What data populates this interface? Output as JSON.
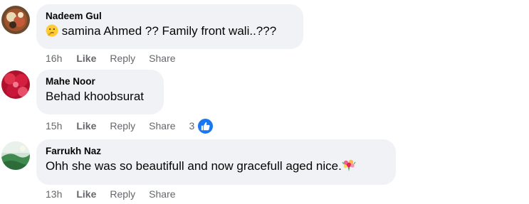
{
  "comments": [
    {
      "author": "Nadeem Gul",
      "text": "samina Ahmed ?? Family front wali..???",
      "leading_emoji": "thinking-face",
      "time": "16h",
      "actions": [
        "Like",
        "Reply",
        "Share"
      ]
    },
    {
      "author": "Mahe Noor",
      "text": "Behad khoobsurat",
      "time": "15h",
      "actions": [
        "Like",
        "Reply",
        "Share"
      ],
      "reaction_count": "3",
      "reaction_icon": "like-icon"
    },
    {
      "author": "Farrukh Naz",
      "text": "Ohh she was so beautifull and now gracefull aged nice.",
      "trailing_emoji": "bouquet",
      "time": "13h",
      "actions": [
        "Like",
        "Reply",
        "Share"
      ]
    }
  ],
  "colors": {
    "bubble_bg": "#f0f2f5",
    "meta_text": "#65676b",
    "like_blue": "#1877f2"
  }
}
